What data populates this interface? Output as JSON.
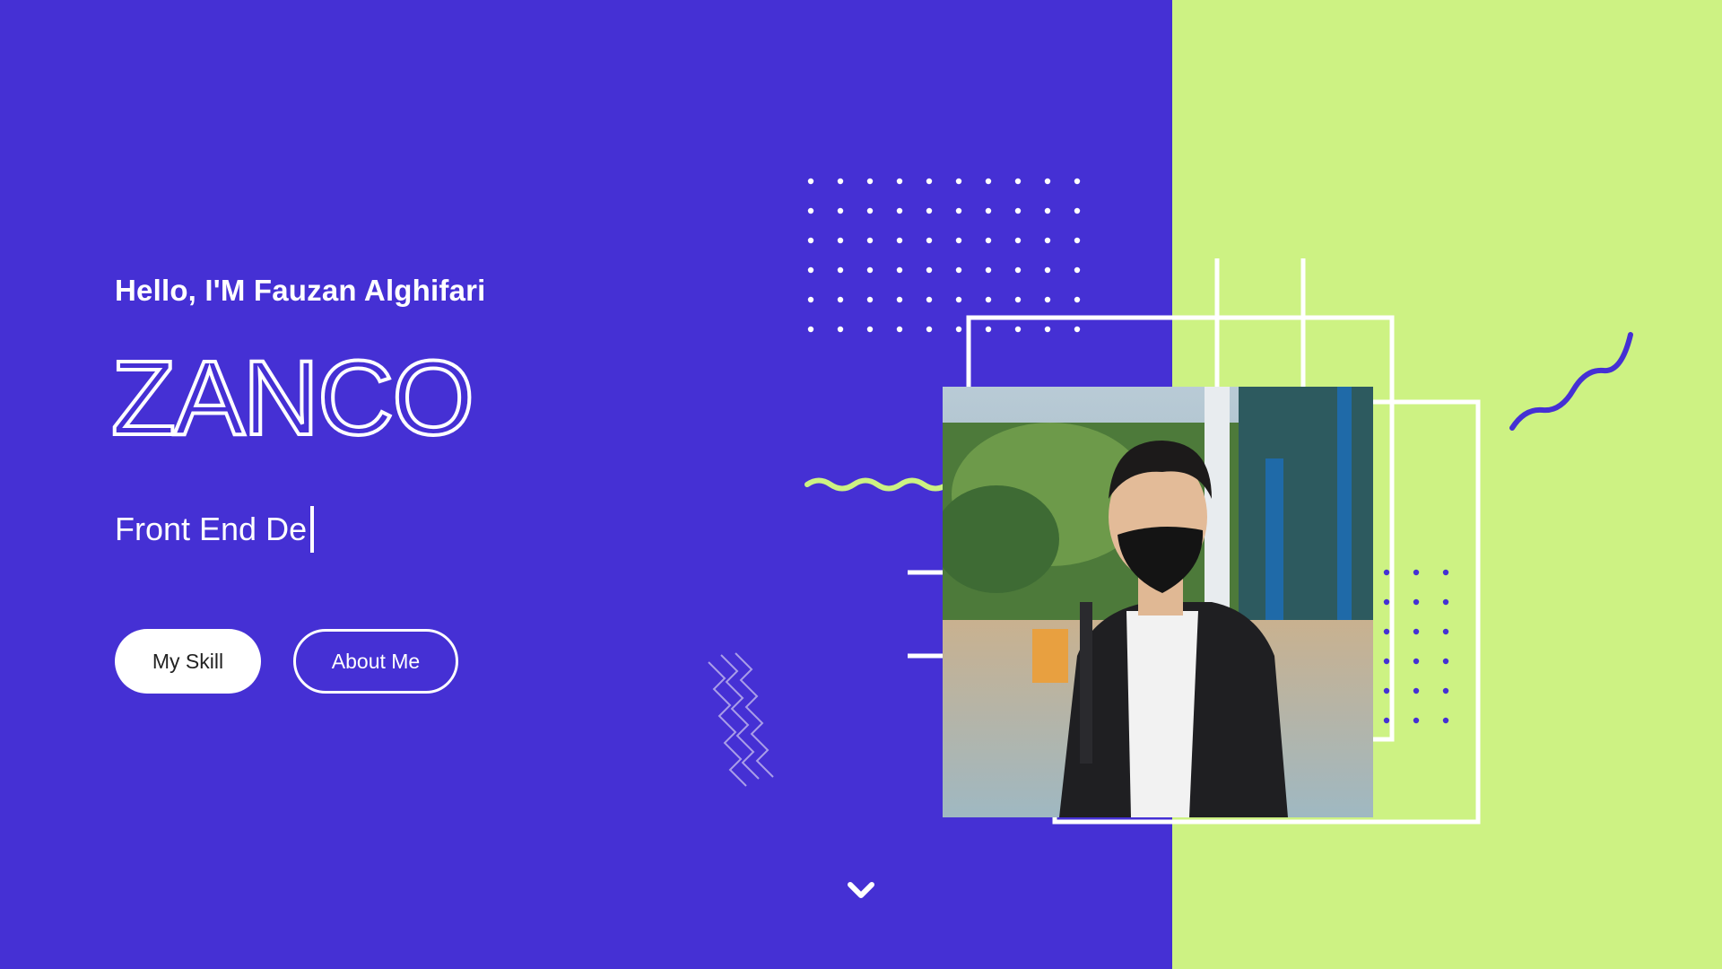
{
  "hero": {
    "greeting": "Hello, I'M Fauzan Alghifari",
    "brand": "ZANCO",
    "typed_role": "Front End De"
  },
  "buttons": {
    "skill_label": "My Skill",
    "about_label": "About Me"
  },
  "icons": {
    "scroll": "chevron-down-icon"
  },
  "colors": {
    "primary": "#4530d4",
    "accent": "#cdf283",
    "text": "#ffffff"
  }
}
